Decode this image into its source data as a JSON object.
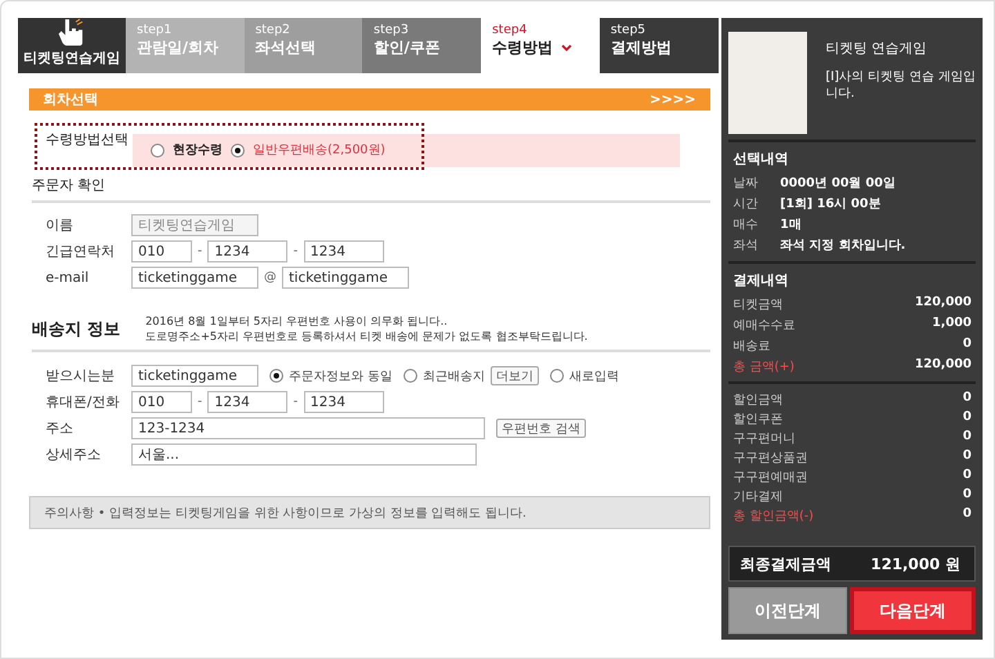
{
  "logo": {
    "text": "티켓팅연습게임"
  },
  "steps": [
    {
      "step": "step1",
      "label": "관람일/회차",
      "selected": false,
      "color": "#b3b3b3"
    },
    {
      "step": "step2",
      "label": "좌석선택",
      "selected": false,
      "color": "#9e9e9e"
    },
    {
      "step": "step3",
      "label": "할인/쿠폰",
      "selected": false,
      "color": "#7a7a7a"
    },
    {
      "step": "step4",
      "label": "수령방법",
      "selected": true,
      "color": "#ffffff"
    },
    {
      "step": "step5",
      "label": "결제방법",
      "selected": false,
      "color": "#3a3a3a"
    }
  ],
  "section_bar": {
    "title": "회차선택",
    "arrows": ">>>>"
  },
  "receive_method": {
    "label": "수령방법선택",
    "options": [
      {
        "label": "현장수령",
        "selected": false
      },
      {
        "label": "일반우편배송(2,500원)",
        "selected": true
      }
    ]
  },
  "orderer": {
    "title": "주문자 확인",
    "name": {
      "label": "이름",
      "value": "티켓팅연습게임",
      "disabled": true
    },
    "phone": {
      "label": "긴급연락처",
      "parts": [
        "010",
        "1234",
        "1234"
      ],
      "separator": "-"
    },
    "email": {
      "label": "e-mail",
      "user": "ticketinggame",
      "at": "@",
      "domain": "ticketinggame"
    }
  },
  "shipping": {
    "title": "배송지 정보",
    "notice": [
      "2016년 8월 1일부터 5자리 우편번호 사용이 의무화 됩니다..",
      "도로명주소+5자리 우편번호로 등록하셔서 티켓 배송에 문제가 없도록 협조부탁드립니다."
    ],
    "receiver": {
      "label": "받으시는분",
      "value": "ticketinggame",
      "options": [
        {
          "label": "주문자정보와 동일",
          "selected": true
        },
        {
          "label": "최근배송지",
          "selected": false,
          "button": "더보기"
        },
        {
          "label": "새로입력",
          "selected": false
        }
      ]
    },
    "mobile": {
      "label": "휴대폰/전화",
      "parts": [
        "010",
        "1234",
        "1234"
      ],
      "separator": "-"
    },
    "address": {
      "label": "주소",
      "value": "123-1234",
      "button": "우편번호 검색"
    },
    "detail": {
      "label": "상세주소",
      "value": "서울..."
    }
  },
  "notice": "주의사항 • 입력정보는 티켓팅게임을 위한 사항이므로 가상의 정보를 입력해도 됩니다.",
  "panel": {
    "product": {
      "title": "티켓팅 연습게임",
      "description": "[I]사의 티켓팅 연습 게임입니다."
    },
    "selection": {
      "title": "선택내역",
      "rows": [
        {
          "label": "날짜",
          "value": "0000년 00월 00일"
        },
        {
          "label": "시간",
          "value": "[1회] 16시 00분"
        },
        {
          "label": "매수",
          "value": "1매"
        },
        {
          "label": "좌석",
          "value": "좌석 지정 회차입니다."
        }
      ]
    },
    "payment": {
      "title": "결제내역",
      "rows": [
        {
          "label": "티켓금액",
          "value": "120,000",
          "kind": "item"
        },
        {
          "label": "예매수수료",
          "value": "1,000",
          "kind": "item"
        },
        {
          "label": "배송료",
          "value": "0",
          "kind": "item"
        },
        {
          "label": "총 금액(+)",
          "value": "120,000",
          "kind": "total"
        }
      ]
    },
    "discounts": [
      {
        "label": "할인금액",
        "value": "0",
        "kind": "item"
      },
      {
        "label": "할인쿠폰",
        "value": "0",
        "kind": "item"
      },
      {
        "label": "구구편머니",
        "value": "0",
        "kind": "item"
      },
      {
        "label": "구구편상품권",
        "value": "0",
        "kind": "item"
      },
      {
        "label": "구구편예매권",
        "value": "0",
        "kind": "item"
      },
      {
        "label": "기타결제",
        "value": "0",
        "kind": "item"
      },
      {
        "label": "총 할인금액(-)",
        "value": "0",
        "kind": "total"
      }
    ],
    "final": {
      "label": "최종결제금액",
      "amount": "121,000",
      "unit": "원"
    },
    "buttons": [
      {
        "label": "이전단계",
        "kind": "prev",
        "highlighted": false
      },
      {
        "label": "다음단계",
        "kind": "next",
        "highlighted": true
      }
    ]
  }
}
